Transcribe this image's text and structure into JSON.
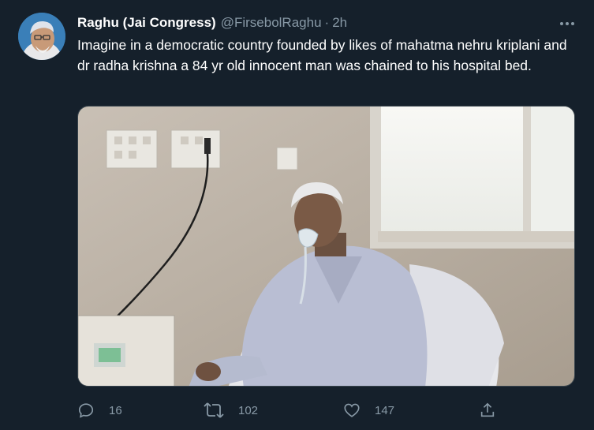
{
  "tweet": {
    "display_name": "Raghu (Jai Congress)",
    "handle": "@FirsebolRaghu",
    "separator": "·",
    "time": "2h",
    "text": "Imagine in a democratic country founded by likes of mahatma nehru kriplani and dr radha krishna a 84 yr old innocent man was chained to his hospital bed.",
    "avatar_icon": "profile-avatar",
    "media_icon": "hospital-photo",
    "actions": {
      "reply_count": "16",
      "retweet_count": "102",
      "like_count": "147"
    }
  },
  "colors": {
    "background": "#15202b",
    "secondary_text": "#8899a6",
    "primary_text": "#ffffff",
    "border": "#38444d"
  }
}
